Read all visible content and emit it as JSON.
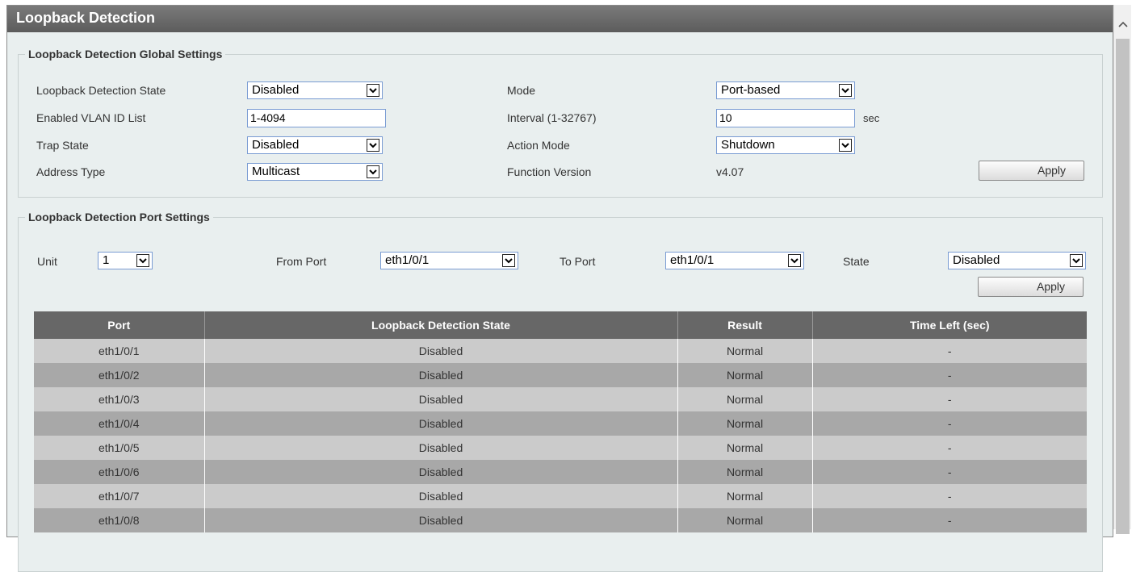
{
  "window": {
    "title": "Loopback Detection"
  },
  "global": {
    "legend": "Loopback Detection Global Settings",
    "state_label": "Loopback Detection State",
    "state_value": "Disabled",
    "vlan_label": "Enabled VLAN ID List",
    "vlan_value": "1-4094",
    "trap_label": "Trap State",
    "trap_value": "Disabled",
    "address_label": "Address Type",
    "address_value": "Multicast",
    "mode_label": "Mode",
    "mode_value": "Port-based",
    "interval_label": "Interval (1-32767)",
    "interval_value": "10",
    "interval_unit": "sec",
    "action_label": "Action Mode",
    "action_value": "Shutdown",
    "version_label": "Function Version",
    "version_value": "v4.07",
    "apply_label": "Apply"
  },
  "port_settings": {
    "legend": "Loopback Detection Port Settings",
    "unit_label": "Unit",
    "unit_value": "1",
    "from_label": "From Port",
    "from_value": "eth1/0/1",
    "to_label": "To Port",
    "to_value": "eth1/0/1",
    "state_label": "State",
    "state_value": "Disabled",
    "apply_label": "Apply"
  },
  "table": {
    "headers": [
      "Port",
      "Loopback Detection State",
      "Result",
      "Time Left (sec)"
    ],
    "rows": [
      [
        "eth1/0/1",
        "Disabled",
        "Normal",
        "-"
      ],
      [
        "eth1/0/2",
        "Disabled",
        "Normal",
        "-"
      ],
      [
        "eth1/0/3",
        "Disabled",
        "Normal",
        "-"
      ],
      [
        "eth1/0/4",
        "Disabled",
        "Normal",
        "-"
      ],
      [
        "eth1/0/5",
        "Disabled",
        "Normal",
        "-"
      ],
      [
        "eth1/0/6",
        "Disabled",
        "Normal",
        "-"
      ],
      [
        "eth1/0/7",
        "Disabled",
        "Normal",
        "-"
      ],
      [
        "eth1/0/8",
        "Disabled",
        "Normal",
        "-"
      ]
    ]
  },
  "icons": {
    "dropdown": "chevron-down-icon",
    "scroll_up": "chevron-up-icon"
  },
  "colors": {
    "titlebar": "#676767",
    "panel_bg": "#e9efef",
    "table_header": "#676767",
    "row_light": "#cbcbcb",
    "row_dark": "#a8a8a8"
  }
}
